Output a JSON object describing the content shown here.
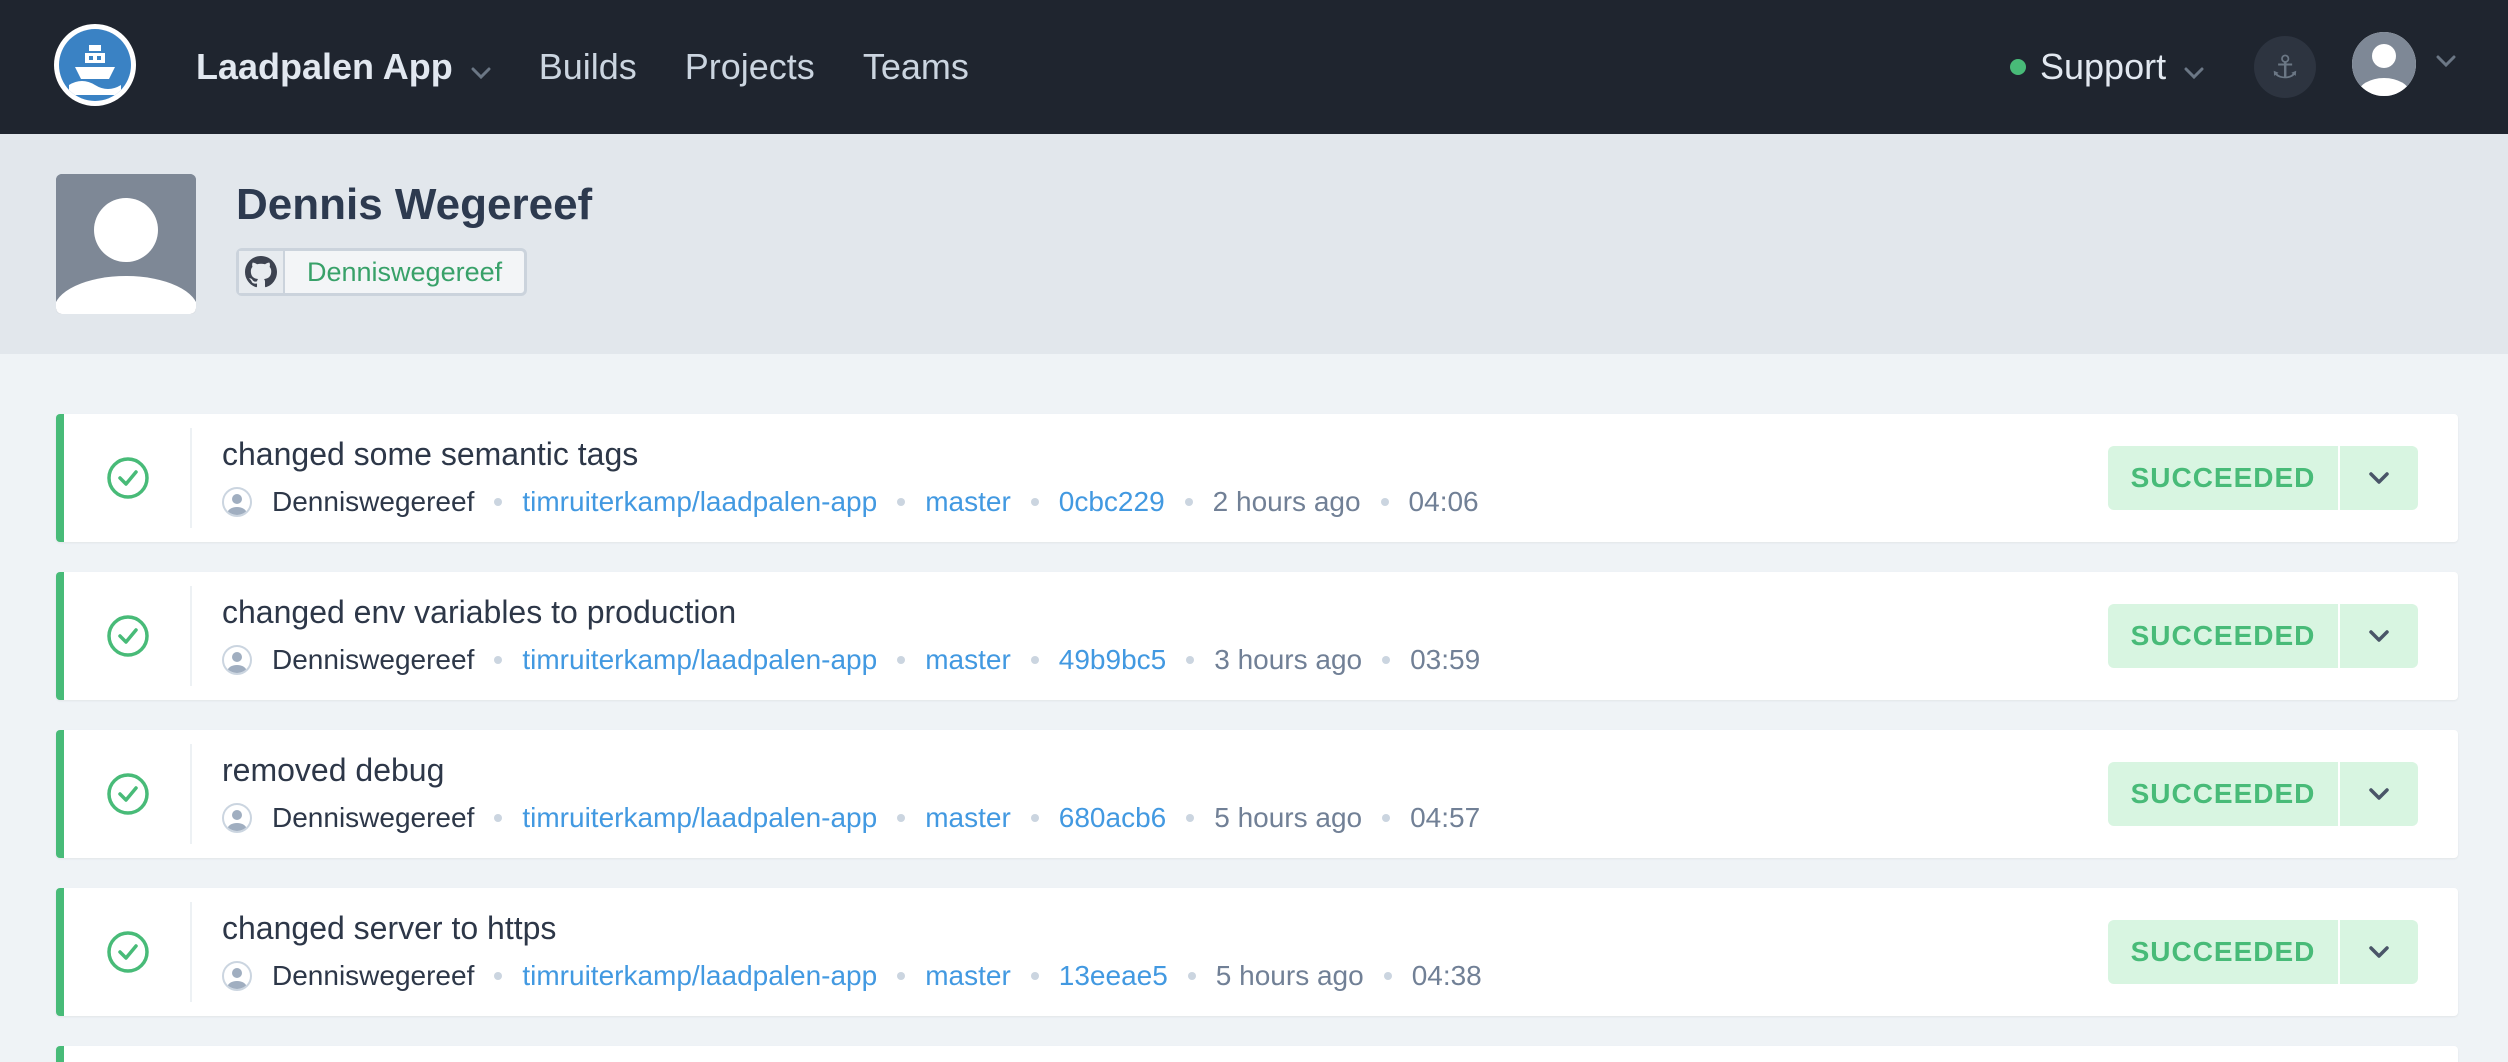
{
  "navbar": {
    "app_name": "Laadpalen App",
    "links": [
      "Builds",
      "Projects",
      "Teams"
    ],
    "support_label": "Support",
    "colors": {
      "background": "#1f252f",
      "status_dot": "#48bb78"
    }
  },
  "profile": {
    "name": "Dennis Wegereef",
    "github_username": "Denniswegereef"
  },
  "builds": [
    {
      "message": "changed some semantic tags",
      "author": "Denniswegereef",
      "repo": "timruiterkamp/laadpalen-app",
      "branch": "master",
      "commit": "0cbc229",
      "time_ago": "2 hours ago",
      "duration": "04:06",
      "status": "SUCCEEDED"
    },
    {
      "message": "changed env variables to production",
      "author": "Denniswegereef",
      "repo": "timruiterkamp/laadpalen-app",
      "branch": "master",
      "commit": "49b9bc5",
      "time_ago": "3 hours ago",
      "duration": "03:59",
      "status": "SUCCEEDED"
    },
    {
      "message": "removed debug",
      "author": "Denniswegereef",
      "repo": "timruiterkamp/laadpalen-app",
      "branch": "master",
      "commit": "680acb6",
      "time_ago": "5 hours ago",
      "duration": "04:57",
      "status": "SUCCEEDED"
    },
    {
      "message": "changed server to https",
      "author": "Denniswegereef",
      "repo": "timruiterkamp/laadpalen-app",
      "branch": "master",
      "commit": "13eeae5",
      "time_ago": "5 hours ago",
      "duration": "04:38",
      "status": "SUCCEEDED"
    }
  ],
  "colors": {
    "success": "#48bb78",
    "success_bg": "#d8f5e1",
    "link": "#4299e1"
  }
}
